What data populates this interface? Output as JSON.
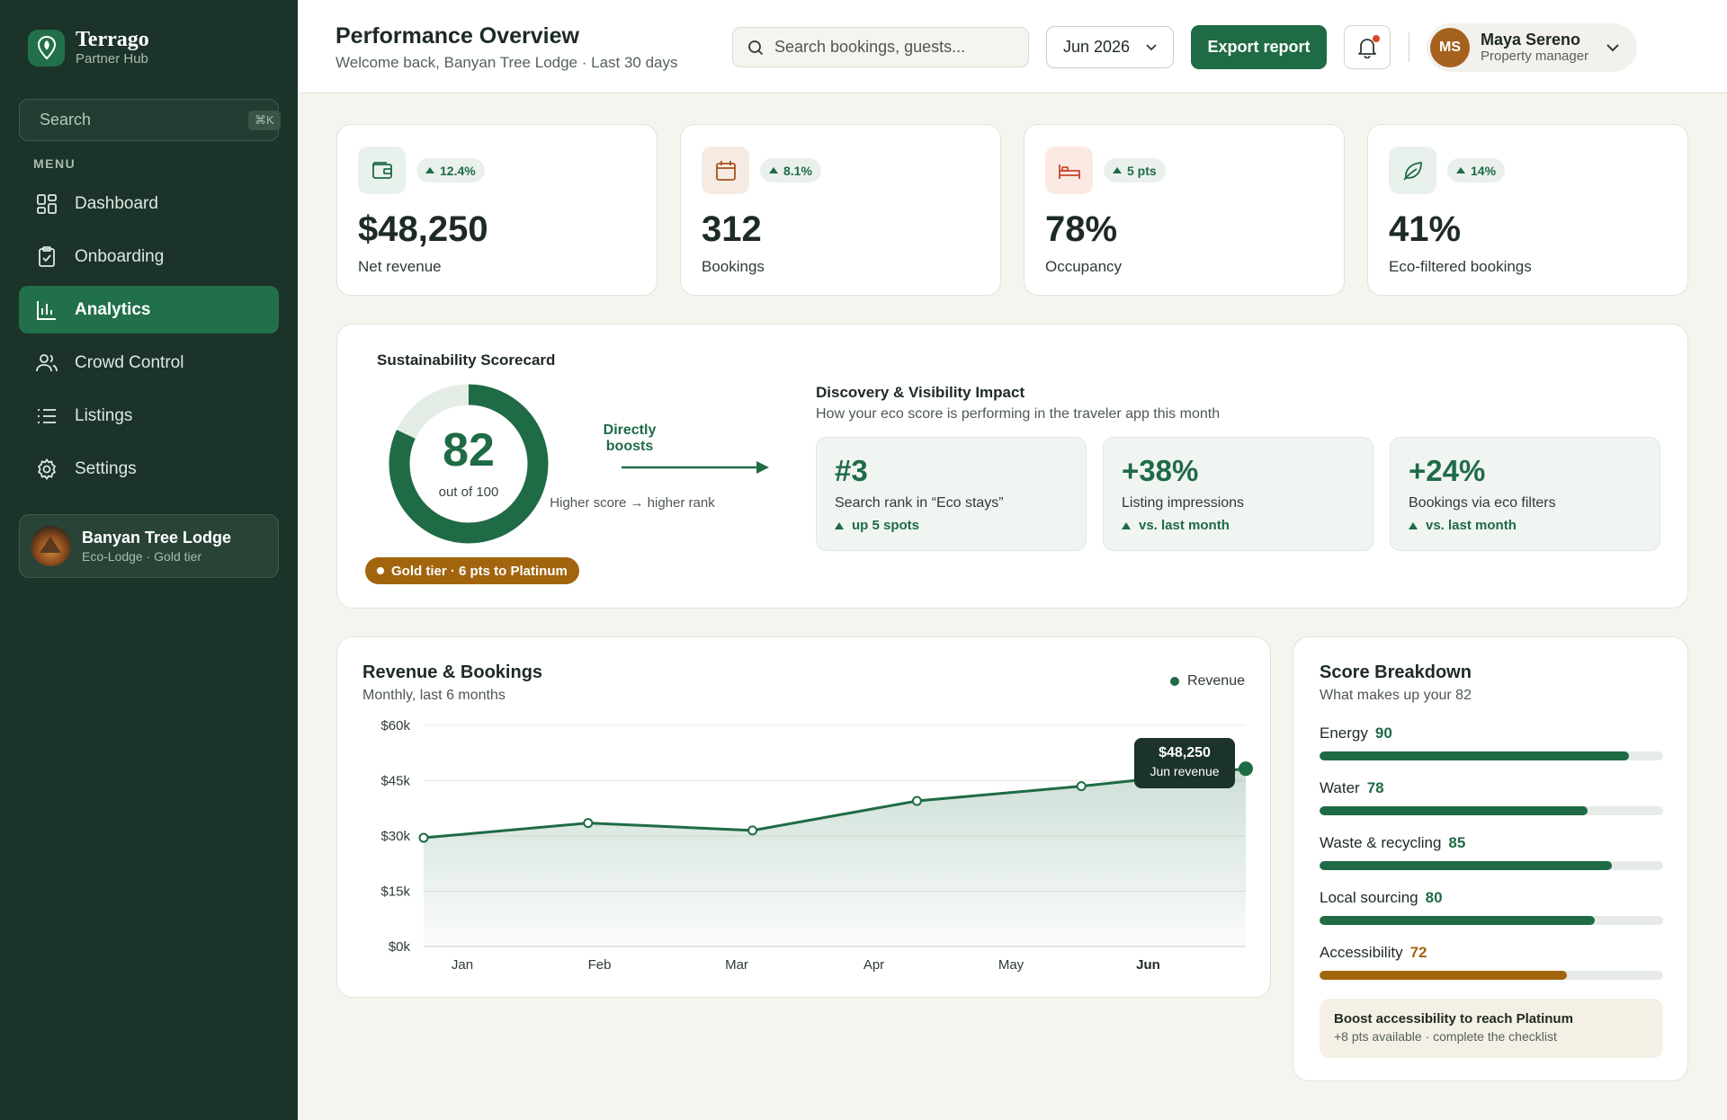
{
  "brand": {
    "name": "Terrago",
    "subtitle": "Partner Hub"
  },
  "sidebar": {
    "search_placeholder": "Search",
    "search_shortcut": "⌘K",
    "menu_label": "MENU",
    "items": [
      {
        "label": "Dashboard",
        "icon": "dashboard-icon"
      },
      {
        "label": "Onboarding",
        "icon": "clipboard-icon"
      },
      {
        "label": "Analytics",
        "icon": "bar-chart-icon",
        "active": true
      },
      {
        "label": "Crowd Control",
        "icon": "users-icon"
      },
      {
        "label": "Listings",
        "icon": "list-icon"
      },
      {
        "label": "Settings",
        "icon": "gear-icon"
      }
    ],
    "property": {
      "name": "Banyan Tree Lodge",
      "subtitle": "Eco-Lodge · Gold tier"
    }
  },
  "header": {
    "title": "Performance Overview",
    "subtitle": "Welcome back, Banyan Tree Lodge · Last 30 days",
    "search_placeholder": "Search bookings, guests...",
    "date_label": "Jun 2026",
    "export_label": "Export report",
    "user": {
      "initials": "MS",
      "name": "Maya Sereno",
      "role": "Property manager"
    }
  },
  "kpis": [
    {
      "value": "$48,250",
      "label": "Net revenue",
      "delta": "12.4%",
      "icon": "wallet-icon",
      "tint": "#e9f1ec",
      "color": "#1f6b46"
    },
    {
      "value": "312",
      "label": "Bookings",
      "delta": "8.1%",
      "icon": "calendar-icon",
      "tint": "#f5ebe2",
      "color": "#a5521f"
    },
    {
      "value": "78%",
      "label": "Occupancy",
      "delta": "5 pts",
      "icon": "bed-icon",
      "tint": "#fbe9e3",
      "color": "#c8462a"
    },
    {
      "value": "41%",
      "label": "Eco-filtered bookings",
      "delta": "14%",
      "icon": "leaf-icon",
      "tint": "#e9f1ec",
      "color": "#1f6b46"
    }
  ],
  "scorecard": {
    "title": "Sustainability Scorecard",
    "score": 82,
    "score_display": "82",
    "out_of": "out of 100",
    "tier_label": "Gold tier · 6 pts to Platinum",
    "boost_label": "Directly boosts",
    "boost_sub": "Higher score → higher rank",
    "discovery_title": "Discovery & Visibility Impact",
    "discovery_sub": "How your eco score is performing in the traveler app this month",
    "metrics": [
      {
        "value": "#3",
        "label": "Search rank in “Eco stays”",
        "delta": "up 5 spots"
      },
      {
        "value": "+38%",
        "label": "Listing impressions",
        "delta": "vs. last month"
      },
      {
        "value": "+24%",
        "label": "Bookings via eco filters",
        "delta": "vs. last month"
      }
    ]
  },
  "revenue": {
    "title": "Revenue & Bookings",
    "subtitle": "Monthly, last 6 months",
    "legend": "Revenue",
    "tooltip_value": "$48,250",
    "tooltip_label": "Jun revenue"
  },
  "chart_data": {
    "type": "area",
    "categories": [
      "Jan",
      "Feb",
      "Mar",
      "Apr",
      "May",
      "Jun"
    ],
    "series": [
      {
        "name": "Revenue",
        "values": [
          29500,
          33500,
          31500,
          39500,
          43500,
          48250
        ]
      }
    ],
    "ylim": [
      0,
      60000
    ],
    "yticks": [
      "$60k",
      "$45k",
      "$30k",
      "$15k",
      "$0k"
    ],
    "ytick_values": [
      60000,
      45000,
      30000,
      15000,
      0
    ],
    "grid": true,
    "legend": "top-right"
  },
  "breakdown": {
    "title": "Score Breakdown",
    "subtitle": "What makes up your 82",
    "items": [
      {
        "name": "Energy",
        "score": 90,
        "score_display": "90"
      },
      {
        "name": "Water",
        "score": 78,
        "score_display": "78"
      },
      {
        "name": "Waste & recycling",
        "score": 85,
        "score_display": "85"
      },
      {
        "name": "Local sourcing",
        "score": 80,
        "score_display": "80"
      },
      {
        "name": "Accessibility",
        "score": 72,
        "score_display": "72",
        "warn": true
      }
    ],
    "note_title": "Boost accessibility to reach Platinum",
    "note_sub": "+8 pts available · complete the checklist"
  },
  "colors": {
    "accent": "#1f6b46",
    "sidebar": "#1b3329",
    "gold": "#a2650e"
  }
}
